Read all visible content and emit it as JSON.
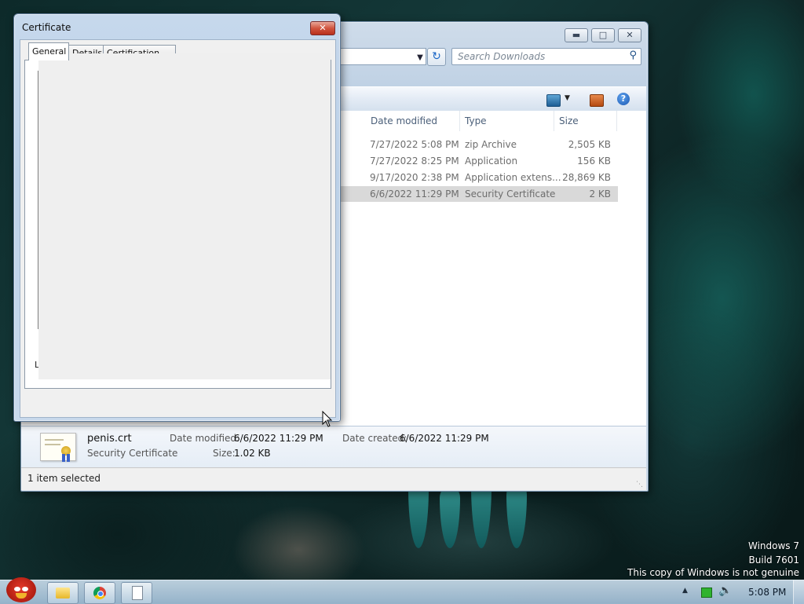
{
  "desktop": {
    "watermark": [
      "Windows 7",
      "Build 7601",
      "This copy of Windows is not genuine"
    ]
  },
  "explorer": {
    "search_placeholder": "Search Downloads",
    "columns": [
      "Date modified",
      "Type",
      "Size"
    ],
    "rows": [
      {
        "date": "7/27/2022 5:08 PM",
        "type": "zip Archive",
        "size": "2,505 KB",
        "selected": false
      },
      {
        "date": "7/27/2022 8:25 PM",
        "type": "Application",
        "size": "156 KB",
        "selected": false
      },
      {
        "date": "9/17/2020 2:38 PM",
        "type": "Application extens...",
        "size": "28,869 KB",
        "selected": false
      },
      {
        "date": "6/6/2022 11:29 PM",
        "type": "Security Certificate",
        "size": "2 KB",
        "selected": true
      }
    ],
    "details": {
      "filename": "penis.crt",
      "filetype": "Security Certificate",
      "date_modified_label": "Date modified:",
      "date_modified": "6/6/2022 11:29 PM",
      "size_label": "Size:",
      "size": "1.02 KB",
      "date_created_label": "Date created:",
      "date_created": "6/6/2022 11:29 PM"
    },
    "status": "1 item selected",
    "icons": {
      "help": "help-icon",
      "view": "views-icon",
      "folder": "new-folder-icon",
      "refresh": "refresh-icon",
      "search": "search-icon"
    }
  },
  "certificate": {
    "title": "Certificate",
    "tabs": [
      "General",
      "Details",
      "Certification Path"
    ],
    "active_tab": "General",
    "truncated_label": "Le"
  },
  "taskbar": {
    "clock": "5:08 PM"
  }
}
